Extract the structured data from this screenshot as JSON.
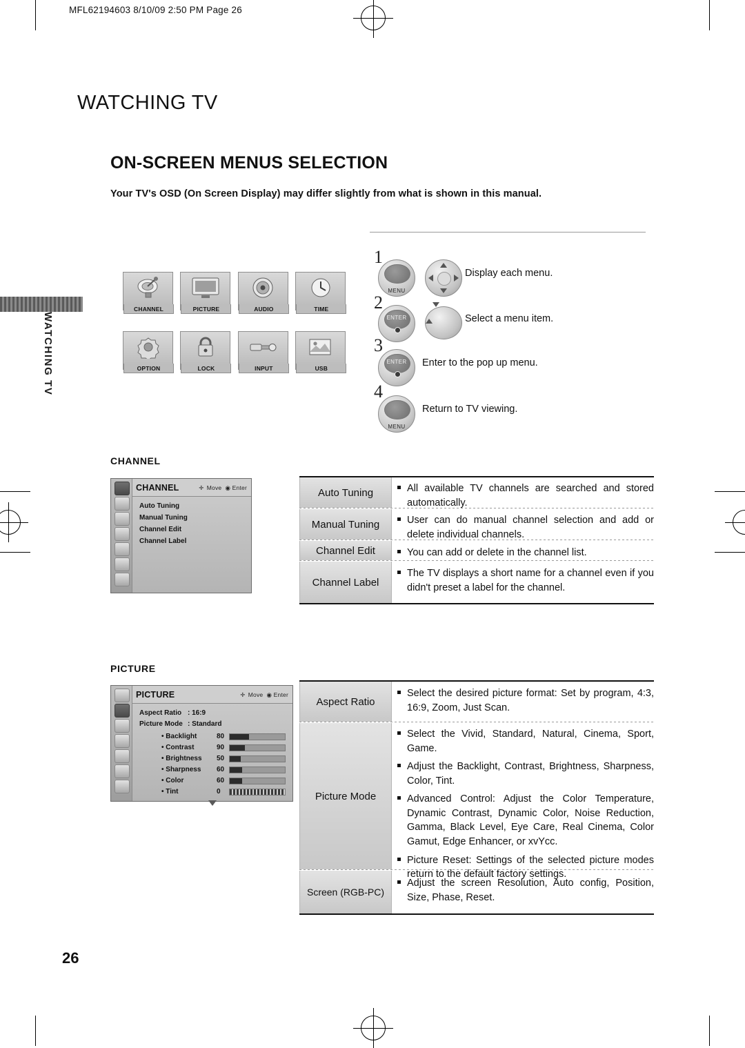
{
  "header": {
    "print_code": "MFL62194603  8/10/09 2:50 PM  Page 26"
  },
  "side_tab": {
    "label": "WATCHING TV"
  },
  "titles": {
    "h1": "WATCHING TV",
    "h2": "ON-SCREEN MENUS SELECTION",
    "intro": "Your TV's OSD (On Screen Display) may differ slightly from what is shown in this manual."
  },
  "menu_icons": [
    {
      "label": "CHANNEL",
      "icon": "satellite-dish-icon"
    },
    {
      "label": "PICTURE",
      "icon": "monitor-icon"
    },
    {
      "label": "AUDIO",
      "icon": "speaker-icon"
    },
    {
      "label": "TIME",
      "icon": "clock-icon"
    },
    {
      "label": "OPTION",
      "icon": "gear-icon"
    },
    {
      "label": "LOCK",
      "icon": "padlock-icon"
    },
    {
      "label": "INPUT",
      "icon": "plug-icon"
    },
    {
      "label": "USB",
      "icon": "usb-icon"
    }
  ],
  "steps": [
    {
      "num": "1",
      "button": "MENU",
      "desc": "Display each menu."
    },
    {
      "num": "2",
      "button": "ENTER",
      "desc": "Select a menu item."
    },
    {
      "num": "3",
      "button": "ENTER",
      "desc": "Enter to the pop up menu."
    },
    {
      "num": "4",
      "button": "MENU",
      "desc": "Return to TV viewing."
    }
  ],
  "channel_section": {
    "label": "CHANNEL",
    "osd": {
      "title": "CHANNEL",
      "hint_move": "Move",
      "hint_enter": "Enter",
      "items": [
        "Auto Tuning",
        "Manual Tuning",
        "Channel Edit",
        "Channel Label"
      ]
    },
    "rows": [
      {
        "name": "Auto Tuning",
        "desc": [
          "All available TV channels are searched and stored automatically."
        ]
      },
      {
        "name": "Manual Tuning",
        "desc": [
          "User can do manual channel selection and add or delete individual channels."
        ]
      },
      {
        "name": "Channel Edit",
        "desc": [
          "You can add or delete in the channel list."
        ]
      },
      {
        "name": "Channel Label",
        "desc": [
          "The TV displays a short name for a channel even if you didn't preset a label for the channel."
        ]
      }
    ]
  },
  "picture_section": {
    "label": "PICTURE",
    "osd": {
      "title": "PICTURE",
      "hint_move": "Move",
      "hint_enter": "Enter",
      "rows": [
        {
          "name": "Aspect Ratio",
          "value": ": 16:9"
        },
        {
          "name": "Picture Mode",
          "value": ": Standard"
        }
      ],
      "sliders": [
        {
          "name": "• Backlight",
          "value": "80"
        },
        {
          "name": "• Contrast",
          "value": "90"
        },
        {
          "name": "• Brightness",
          "value": "50"
        },
        {
          "name": "• Sharpness",
          "value": "60"
        },
        {
          "name": "• Color",
          "value": "60"
        },
        {
          "name": "• Tint",
          "value": "0"
        }
      ]
    },
    "rows": [
      {
        "name": "Aspect Ratio",
        "desc": [
          "Select the desired picture format: Set by program, 4:3, 16:9, Zoom, Just Scan."
        ]
      },
      {
        "name": "Picture Mode",
        "desc": [
          "Select the Vivid, Standard, Natural, Cinema, Sport, Game.",
          "Adjust the Backlight, Contrast, Brightness, Sharpness, Color, Tint.",
          "Advanced Control: Adjust the Color Temperature, Dynamic Contrast, Dynamic Color, Noise Reduction, Gamma, Black Level, Eye Care, Real Cinema, Color Gamut, Edge Enhancer, or xvYcc.",
          "Picture Reset: Settings of the selected picture modes return to the default factory settings."
        ]
      },
      {
        "name": "Screen (RGB-PC)",
        "desc": [
          "Adjust the screen Resolution, Auto config, Position, Size, Phase, Reset."
        ]
      }
    ]
  },
  "page_number": "26"
}
